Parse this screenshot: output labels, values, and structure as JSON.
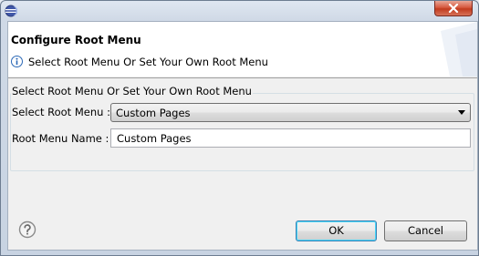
{
  "dialog": {
    "title": "Configure Root Menu",
    "message": "Select Root Menu Or Set Your Own Root Menu"
  },
  "group": {
    "legend": "Select Root Menu Or Set Your Own Root Menu",
    "select_label": "Select Root Menu :",
    "select_value": "Custom Pages",
    "name_label": "Root Menu Name :",
    "name_value": "Custom Pages"
  },
  "buttons": {
    "ok_label": "OK",
    "cancel_label": "Cancel"
  },
  "icons": {
    "app": "eclipse-icon",
    "info": "info-icon",
    "help": "help-icon",
    "close": "close-icon",
    "dropdown": "chevron-down-icon"
  },
  "colors": {
    "close_button": "#c13b1e",
    "default_button_border": "#3c7fb1",
    "info_icon": "#2b68b6"
  }
}
